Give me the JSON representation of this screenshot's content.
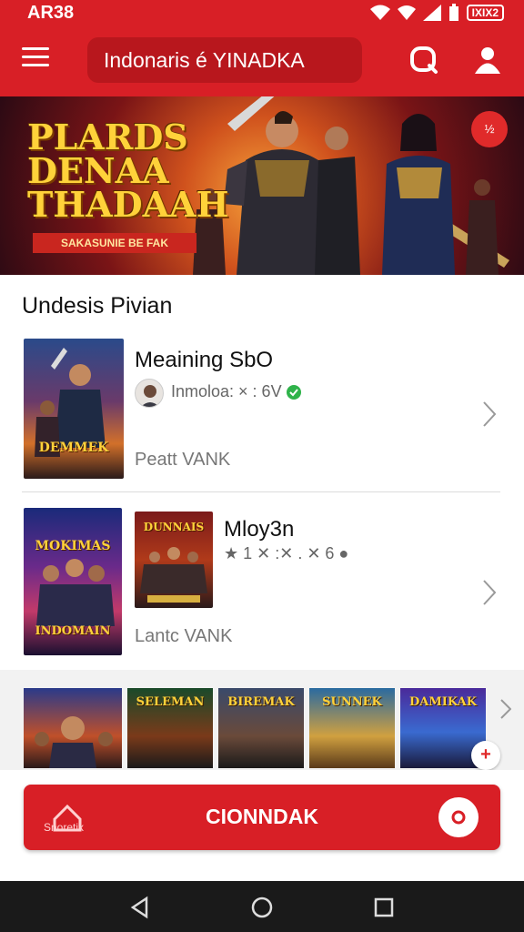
{
  "status_bar": {
    "time": "AR38",
    "battery": "IXIX2"
  },
  "header": {
    "title": "Indonaris é YINADKA"
  },
  "hero": {
    "title_lines": [
      "PLARDS",
      "DENAA",
      "THADAAH"
    ],
    "subtitle": "SAKASUNIE BE FAK",
    "badge": "½"
  },
  "section": {
    "title": "Undesis Pivian"
  },
  "items": [
    {
      "title": "Meaining SbO",
      "meta": "Inmoloa: × : 6V",
      "footer": "Peatt VANK",
      "poster_text": "DEMMEK"
    },
    {
      "title": "Mloy3n",
      "meta": "★ 1 ✕ :✕ . ✕ 6 ●",
      "footer": "Lantc VANK",
      "poster_text": "INDOMAIN",
      "poster_top": "MOKIMAS",
      "second_poster_text": "DUNNAIS"
    }
  ],
  "strip": {
    "thumbs": [
      "",
      "SELEMAN",
      "BIREMAK",
      "SUNNEK",
      "DAMIKAK"
    ]
  },
  "cta": {
    "home_label": "Snoretix",
    "label": "CIONNDAK"
  },
  "colors": {
    "brand": "#d81f26",
    "brand_dark": "#b8171d",
    "background": "#ffffff",
    "nav": "#1a1a1a"
  }
}
